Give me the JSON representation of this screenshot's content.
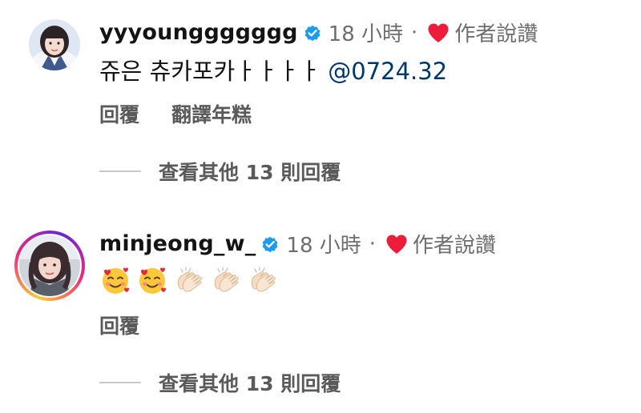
{
  "comments": [
    {
      "username": "yyyounggggggg",
      "time": "18 小時",
      "separator": "·",
      "liked_by_author": "作者說讚",
      "text": "쥬은 츄카포카ㅏㅏㅏㅏ ",
      "mention": "@0724.32",
      "actions": {
        "reply": "回覆",
        "translate": "翻譯年糕"
      },
      "view_replies": "查看其他 13 則回覆"
    },
    {
      "username": "minjeong_w_",
      "time": "18 小時",
      "separator": "·",
      "liked_by_author": "作者說讚",
      "emojis": [
        "smiling-face-with-hearts",
        "smiling-face-with-hearts",
        "clapping-hands",
        "clapping-hands",
        "clapping-hands"
      ],
      "actions": {
        "reply": "回覆"
      },
      "view_replies": "查看其他 13 則回覆"
    }
  ],
  "colors": {
    "verified_blue": "#1d9bf0",
    "heart_red": "#ed1c3b",
    "mention_blue": "#00376b",
    "muted_text": "#6e6e6e"
  }
}
